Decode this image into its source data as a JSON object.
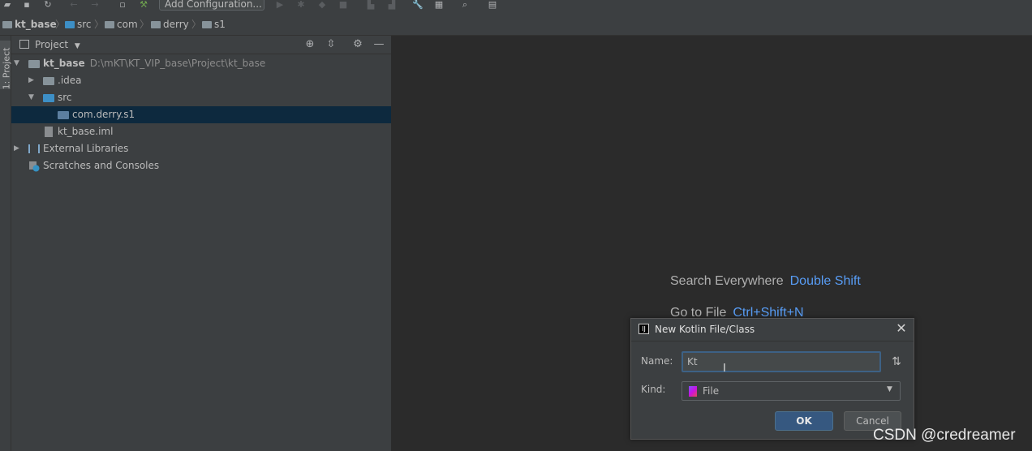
{
  "toolbar": {
    "add_configuration_label": "Add Configuration..."
  },
  "breadcrumb": {
    "items": [
      "kt_base",
      "src",
      "com",
      "derry",
      "s1"
    ]
  },
  "left_stripe": {
    "project_tab_label": "1: Project"
  },
  "project_panel": {
    "title": "Project",
    "tree": {
      "root": {
        "label": "kt_base",
        "path": "D:\\mKT\\KT_VIP_base\\Project\\kt_base"
      },
      "idea": {
        "label": ".idea"
      },
      "src": {
        "label": "src"
      },
      "package": {
        "label": "com.derry.s1"
      },
      "iml": {
        "label": "kt_base.iml"
      },
      "external_libraries": {
        "label": "External Libraries"
      },
      "scratches": {
        "label": "Scratches and Consoles"
      }
    }
  },
  "editor_hints": [
    {
      "label": "Search Everywhere",
      "key": "Double Shift"
    },
    {
      "label": "Go to File",
      "key": "Ctrl+Shift+N"
    }
  ],
  "dialog": {
    "title": "New Kotlin File/Class",
    "name_label": "Name:",
    "name_value": "Kt",
    "kind_label": "Kind:",
    "kind_value": "File",
    "ok_label": "OK",
    "cancel_label": "Cancel"
  },
  "watermark": "CSDN @credreamer",
  "colors": {
    "accent_blue": "#589df6",
    "selection": "#0d293e",
    "ok_button": "#365880"
  }
}
